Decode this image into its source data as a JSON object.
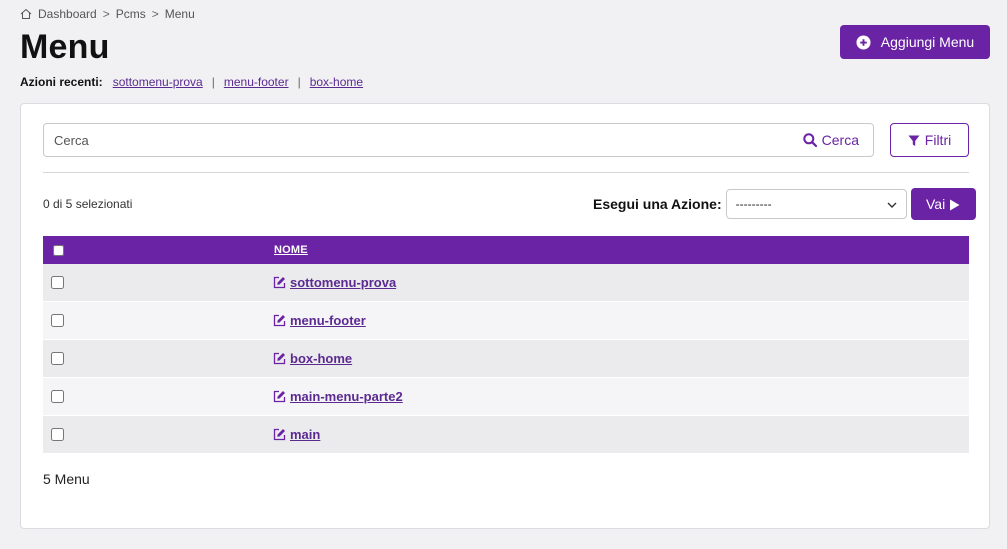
{
  "breadcrumb": {
    "items": [
      "Dashboard",
      "Pcms",
      "Menu"
    ],
    "separator": ">"
  },
  "page_title": "Menu",
  "add_button": {
    "label": "Aggiungi Menu",
    "icon": "plus-circle-icon"
  },
  "recent_actions": {
    "label": "Azioni recenti:",
    "items": [
      "sottomenu-prova",
      "menu-footer",
      "box-home"
    ],
    "separator": "|"
  },
  "search": {
    "placeholder": "Cerca",
    "button_label": "Cerca",
    "icon": "search-icon"
  },
  "filter_button": {
    "label": "Filtri",
    "icon": "filter-icon"
  },
  "selection": {
    "text": "0 di 5 selezionati"
  },
  "action": {
    "label": "Esegui una Azione:",
    "selected": "---------",
    "go_label": "Vai",
    "go_icon": "play-icon"
  },
  "table": {
    "header": {
      "name": "NOME"
    },
    "rows": [
      {
        "name": "sottomenu-prova"
      },
      {
        "name": "menu-footer"
      },
      {
        "name": "box-home"
      },
      {
        "name": "main-menu-parte2"
      },
      {
        "name": "main"
      }
    ]
  },
  "footer": {
    "total": "5 Menu"
  },
  "colors": {
    "primary": "#6a23a5",
    "link": "#5b2a91",
    "background": "#f1f1f3",
    "row_odd": "#ebebed",
    "row_even": "#f5f5f7"
  }
}
